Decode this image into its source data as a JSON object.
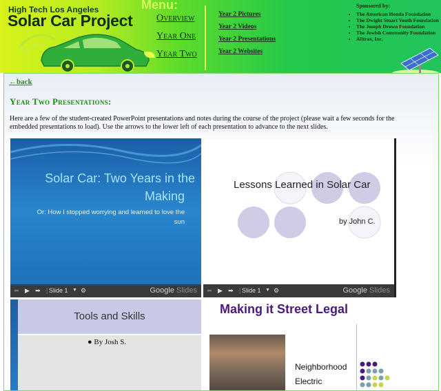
{
  "header": {
    "brand_top": "High Tech Los Angeles",
    "brand_main": "Solar Car Project",
    "menu_heading": "Menu:",
    "main_menu": [
      "Overview",
      "Year One",
      "Year Two"
    ],
    "sub_menu": [
      "Year 2 Pictures",
      "Year 2 Videos",
      "Year 2 Presentations",
      "Year 2 Websites"
    ],
    "sponsors_heading": "Sponsored by:",
    "sponsors": [
      "The American Honda Foundation",
      "The Dwight Stuart Youth Foundation",
      "The Joseph Drown Foundation",
      "The Jewish Community Foundation",
      "Alltrax, Inc."
    ]
  },
  "content": {
    "back_label": "back",
    "back_arrow": "←",
    "heading": "Year Two Presentations:",
    "intro": "Here are a few of the student-created PowerPoint presentations and notes during the course of the project (please wait a few seconds for the embedded presentations to load). Use the arrows to the lower left of each presentation to advance to the next slides."
  },
  "presentations": [
    {
      "title": "Solar Car: Two Years in the",
      "title2": "Making",
      "subtitle": "Or: How I stopped worrying and learned to love the",
      "subtitle2": "sun",
      "slide_label": "Slide 1",
      "brand": "Google",
      "brand2": "Slides"
    },
    {
      "title": "Lessons Learned in Solar Car",
      "byline": "by John C.",
      "slide_label": "Slide 1",
      "brand": "Google",
      "brand2": "Slides"
    },
    {
      "title": "Tools and Skills",
      "byline": "By Josh S."
    },
    {
      "title": "Making it Street Legal",
      "text1": "Neighborhood",
      "text2": "Electric"
    }
  ],
  "colors": {
    "header_green": "#24c84a",
    "accent_lime": "#d8f21a",
    "heading_green": "#1f8a13",
    "slide_blue": "#1f78c4",
    "purple": "#4a1a7a"
  }
}
